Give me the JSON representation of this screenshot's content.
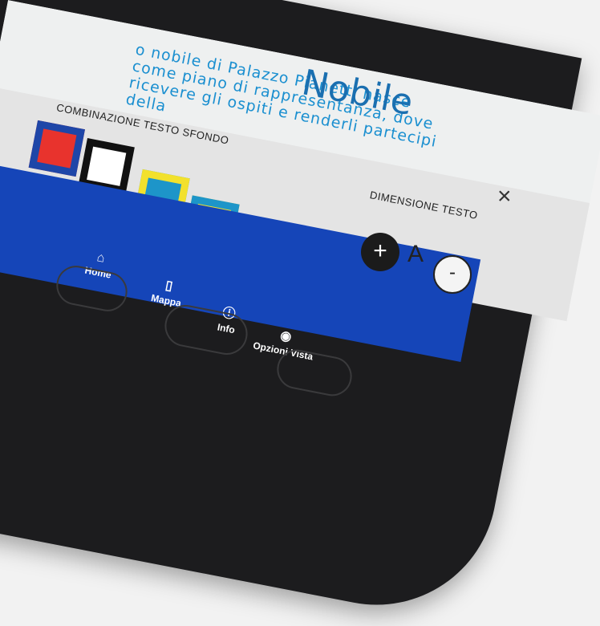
{
  "content": {
    "title": "Nobile",
    "paragraph": "o nobile di Palazzo Pianetti nasce\ncome piano di rappresentanza, dove\nricevere gli ospiti e renderli partecipi della"
  },
  "panel": {
    "combo_label": "COMBINAZIONE TESTO SFONDO",
    "swatches": [
      {
        "name": "red-on-blue",
        "border": "#1e46a8",
        "fill": "#e8332d"
      },
      {
        "name": "white-on-black",
        "border": "#111111",
        "fill": "#ffffff"
      },
      {
        "name": "blue-on-yellow",
        "border": "#f2e12c",
        "fill": "#1d95c9"
      },
      {
        "name": "yellow-on-blue",
        "border": "#1d95c9",
        "fill": "#f2e12c"
      }
    ],
    "close_icon": "×",
    "dim_label": "DIMENSIONE TESTO",
    "increase": "+",
    "font_letter": "A",
    "decrease": "-"
  },
  "nav": {
    "items": [
      {
        "label": "Home",
        "icon": "⌂"
      },
      {
        "label": "Mappa",
        "icon": "▯"
      },
      {
        "label": "Info",
        "icon": "ⓘ"
      },
      {
        "label": "Opzioni Vista",
        "icon": "◉"
      }
    ]
  },
  "colors": {
    "accent": "#1545b8",
    "text_blue": "#1a8fd0"
  }
}
